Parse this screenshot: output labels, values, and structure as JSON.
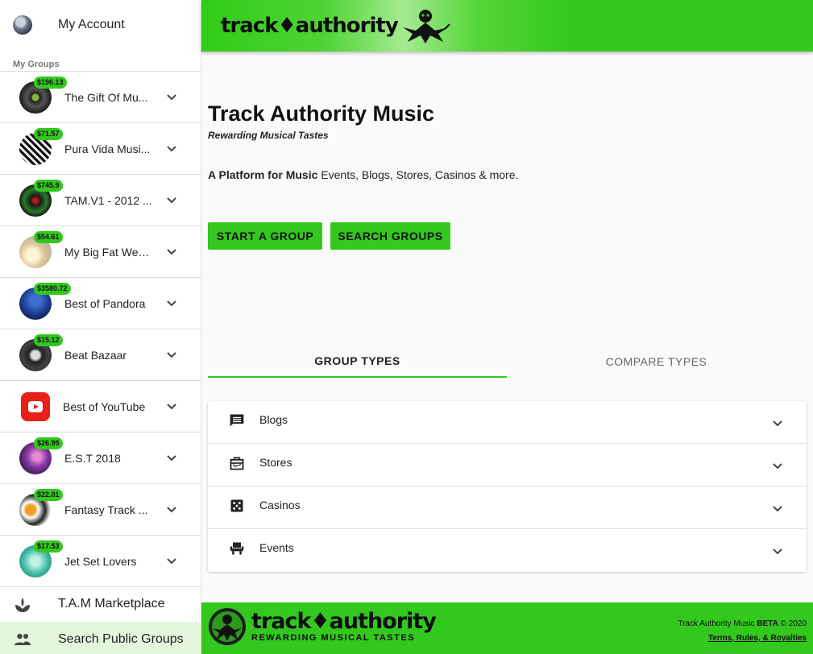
{
  "sidebar": {
    "account_label": "My Account",
    "section_title": "My Groups",
    "groups": [
      {
        "name": "The Gift Of Mu...",
        "badge": "$196.13"
      },
      {
        "name": "Pura Vida Musi...",
        "badge": "$71.57"
      },
      {
        "name": "TAM.V1 - 2012 ...",
        "badge": "$745.9"
      },
      {
        "name": "My Big Fat Wed...",
        "badge": "$54.61"
      },
      {
        "name": "Best of Pandora",
        "badge": "$3580.72"
      },
      {
        "name": "Beat Bazaar",
        "badge": "$15.12"
      },
      {
        "name": "Best of YouTube",
        "badge": ""
      },
      {
        "name": "E.S.T 2018",
        "badge": "$26.95"
      },
      {
        "name": "Fantasy Track ...",
        "badge": "$22.01"
      },
      {
        "name": "Jet Set Lovers",
        "badge": "$17.53"
      }
    ],
    "marketplace_label": "T.A.M Marketplace",
    "search_groups_label": "Search Public Groups"
  },
  "header": {
    "logo_text": "track♦authority"
  },
  "main": {
    "title": "Track Authority Music",
    "subtitle": "Rewarding Musical Tastes",
    "desc_bold": "A Platform for Music",
    "desc_rest": " Events, Blogs, Stores, Casinos & more.",
    "start_group_label": "START A GROUP",
    "search_groups_label": "SEARCH GROUPS",
    "tabs": [
      {
        "label": "GROUP TYPES",
        "active": true
      },
      {
        "label": "COMPARE TYPES",
        "active": false
      }
    ],
    "accordion": [
      {
        "label": "Blogs",
        "icon": "comment-icon"
      },
      {
        "label": "Stores",
        "icon": "store-icon"
      },
      {
        "label": "Casinos",
        "icon": "dice-icon"
      },
      {
        "label": "Events",
        "icon": "event-seat-icon"
      }
    ]
  },
  "footer": {
    "brand": "track♦authority",
    "tagline": "REWARDING MUSICAL TASTES",
    "copyright_name": "Track Authority Music ",
    "copyright_beta": "BETA",
    "copyright_year": " © 2020",
    "terms_link": "Terms, Rules, & Royalties"
  },
  "colors": {
    "accent": "#32c81e",
    "highlight_bg": "#e4f7dc"
  }
}
